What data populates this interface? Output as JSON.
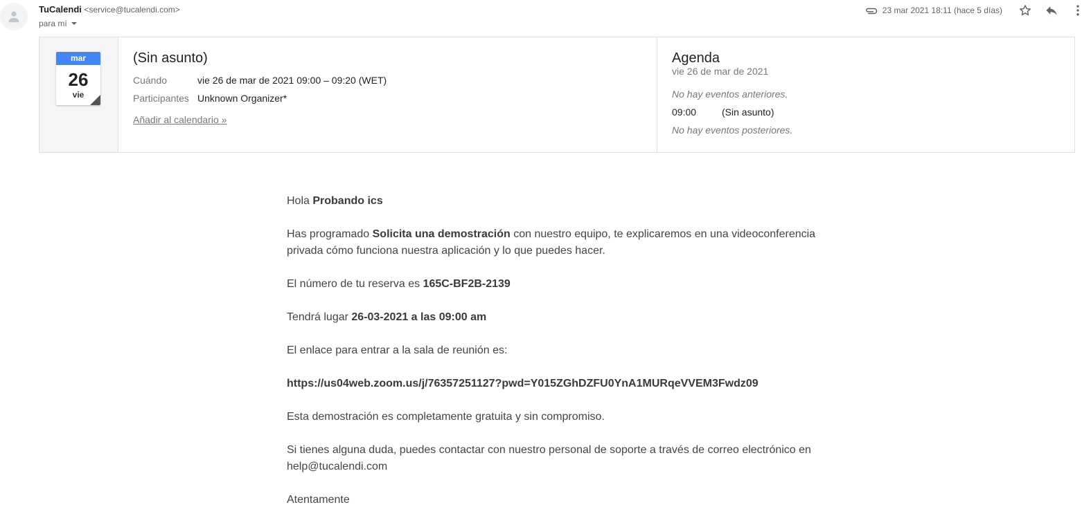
{
  "email": {
    "sender_name": "TuCalendi",
    "sender_email": "<service@tucalendi.com>",
    "recipient": "para mí",
    "date": "23 mar 2021 18:11 (hace 5 días)",
    "icons": [
      "person-icon",
      "paperclip-icon",
      "star-icon",
      "reply-icon",
      "more-vert-icon"
    ]
  },
  "invite": {
    "calendar_icon": {
      "month": "mar",
      "day": "26",
      "weekday": "vie",
      "header_color": "#4285f4"
    },
    "title": "(Sin asunto)",
    "when_label": "Cuándo",
    "when_value": "vie 26 de mar de 2021 09:00 – 09:20 (WET)",
    "participants_label": "Participantes",
    "participants_value": "Unknown Organizer*",
    "add_to_calendar": "Añadir al calendario »"
  },
  "agenda": {
    "title": "Agenda",
    "date": "vie 26 de mar de 2021",
    "no_prior": "No hay eventos anteriores.",
    "event_time": "09:00",
    "event_title": "(Sin asunto)",
    "no_later": "No hay eventos posteriores."
  },
  "body": {
    "greeting_prefix": "Hola ",
    "greeting_name": "Probando ics",
    "p1_prefix": "Has programado ",
    "p1_bold": "Solicita una demostración",
    "p1_suffix": " con nuestro equipo, te explicaremos en una videoconferencia privada cómo funciona nuestra aplicación y lo que puedes hacer.",
    "p2_prefix": "El número de tu reserva es ",
    "p2_bold": "165C-BF2B-2139",
    "p3_prefix": "Tendrá lugar ",
    "p3_bold": "26-03-2021 a las 09:00 am",
    "p4": "El enlace para entrar a la sala de reunión es:",
    "link": "https://us04web.zoom.us/j/76357251127?pwd=Y015ZGhDZFU0YnA1MURqeVVEM3Fwdz09",
    "p5": "Esta demostración es completamente gratuita y sin compromiso.",
    "p6": "Si tienes alguna duda, puedes contactar con nuestro personal de soporte a través de correo electrónico en help@tucalendi.com",
    "closing": "Atentamente"
  }
}
